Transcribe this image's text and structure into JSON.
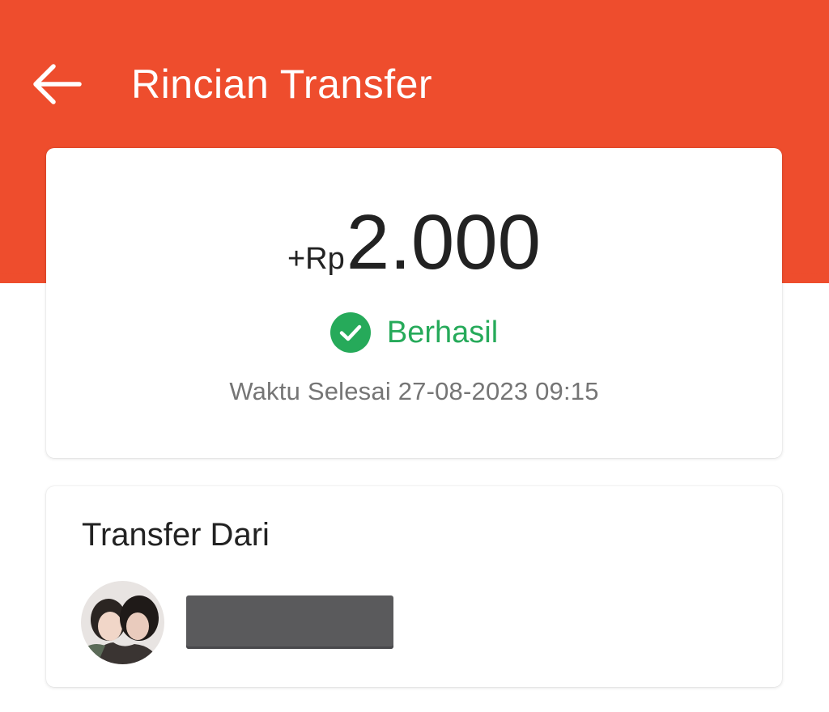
{
  "colors": {
    "header": "#ee4d2d",
    "success": "#26aa5a",
    "text_primary": "#222222",
    "text_secondary": "#757575"
  },
  "header": {
    "back_icon": "arrow-left-icon",
    "title": "Rincian Transfer"
  },
  "transaction": {
    "amount_prefix": "+Rp",
    "amount_value": "2.000",
    "status_icon": "check-circle-icon",
    "status_label": "Berhasil",
    "completed_time": "Waktu Selesai 27-08-2023 09:15"
  },
  "sender": {
    "section_label": "Transfer Dari",
    "avatar": "avatar-photo",
    "name_redacted": true
  }
}
